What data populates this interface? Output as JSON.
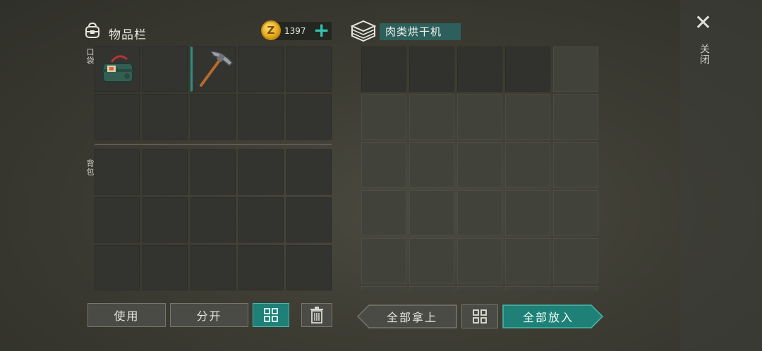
{
  "inventory": {
    "title": "物品栏",
    "pocket_label": "口袋",
    "backpack_label": "背包"
  },
  "currency": {
    "amount": "1397",
    "coin_symbol": "Z",
    "add_symbol": "+"
  },
  "machine": {
    "name": "肉类烘干机"
  },
  "close": {
    "icon": "✕",
    "label": "关闭"
  },
  "buttons": {
    "use": "使用",
    "split": "分开",
    "take_all": "全部拿上",
    "put_all": "全部放入"
  },
  "items": [
    {
      "slot": "pocket-1",
      "icon": "green-supply-bag-icon"
    },
    {
      "slot": "pocket-3",
      "icon": "pickaxe-icon"
    }
  ],
  "colors": {
    "accent": "#1e8076",
    "plus": "#31c3b4",
    "machine_label_bg": "#2d5f5b"
  }
}
